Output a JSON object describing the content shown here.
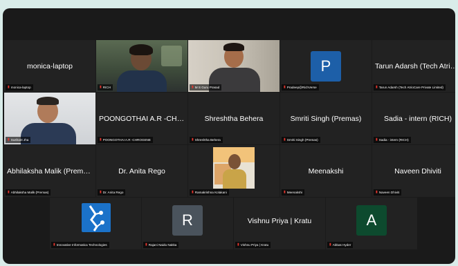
{
  "participants": [
    {
      "name": "monica-laptop",
      "label": "monica-laptop",
      "type": "name"
    },
    {
      "name": "RICH",
      "label": "RICH",
      "type": "video"
    },
    {
      "name": "M S Guru Prasad",
      "label": "M S Guru Prasad",
      "type": "video"
    },
    {
      "name": "Pradeep@RichVerse",
      "label": "Pradeep@RichVerse",
      "type": "avatar",
      "initial": "P",
      "color": "#1d5fa8"
    },
    {
      "name": "Tarun Adarsh (Tech AtrioCar...",
      "label": "Tarun Adarsh (Tech AtrioCare Private Limited)",
      "type": "name"
    },
    {
      "name": "Sushant Jha",
      "label": "Sushant Jha",
      "type": "video"
    },
    {
      "name": "POONGOTHAI A.R -CHROG...",
      "label": "POONGOTHAI A.R -CHROGENE",
      "type": "name"
    },
    {
      "name": "Shreshtha Behera",
      "label": "Shreshtha Behera",
      "type": "name"
    },
    {
      "name": "Smriti Singh (Premas)",
      "label": "Smriti Singh (Premas)",
      "type": "name"
    },
    {
      "name": "Sadia - intern (RICH)",
      "label": "Sadia - intern (RICH)",
      "type": "name"
    },
    {
      "name": "Abhilaksha Malik (Premas)",
      "label": "Abhilaksha Malik (Premas)",
      "type": "name"
    },
    {
      "name": "Dr. Anita Rego",
      "label": "Dr. Anita Rego",
      "type": "name"
    },
    {
      "name": "Ramakrishna Kolakani",
      "label": "Ramakrishna Kolakani",
      "type": "photo"
    },
    {
      "name": "Meenakshi",
      "label": "Meenakshi",
      "type": "name"
    },
    {
      "name": "Naveen Dhiviti",
      "label": "Naveen Dhiviti",
      "type": "name"
    },
    {
      "name": "Innovative Informatica Technologies",
      "label": "Innovative Informatica Technologies",
      "type": "logo",
      "color": "#1b72c9"
    },
    {
      "name": "Rajani Naidu Nakka",
      "label": "Rajani Naidu Nakka",
      "type": "avatar",
      "initial": "R",
      "color": "#4a535c"
    },
    {
      "name": "Vishnu Priya | Kratu",
      "label": "Vishnu Priya | Kratu",
      "type": "name"
    },
    {
      "name": "Abbas Hyder",
      "label": "Abbas Hyder",
      "type": "avatar",
      "initial": "A",
      "color": "#0d4a2e"
    }
  ],
  "colors": {
    "active_speaker": "#3cc24a",
    "muted_mic": "#e8352d",
    "tile_bg": "#222222"
  },
  "icons": {
    "muted": "muted-mic-icon"
  }
}
